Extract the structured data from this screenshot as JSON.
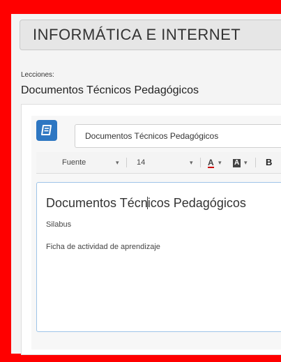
{
  "page": {
    "title": "INFORMÁTICA E INTERNET"
  },
  "lessons": {
    "label": "Lecciones:",
    "current": "Documentos Técnicos Pedagógicos"
  },
  "editor": {
    "name_value": "Documentos Técnicos Pedagógicos",
    "toolbar": {
      "font_label": "Fuente",
      "size_label": "14",
      "text_color_label": "A",
      "bg_color_label": "A",
      "bold_label": "B",
      "caret": "▾"
    },
    "content": {
      "heading_before_cursor": "Documentos Técn",
      "heading_after_cursor": "icos Pedagógicos",
      "paragraphs": [
        "Silabus",
        "Ficha de actividad de aprendizaje"
      ]
    }
  },
  "colors": {
    "frame": "#ff0000",
    "accent": "#2e77c2"
  }
}
